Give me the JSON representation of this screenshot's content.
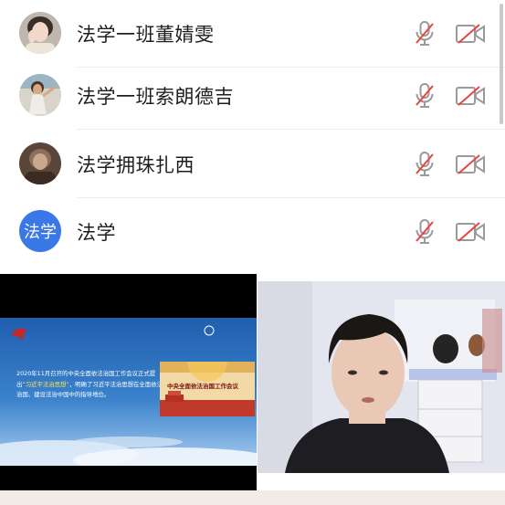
{
  "participants": [
    {
      "name": "法学一班董婧雯",
      "avatar_type": "photo",
      "mic": "muted",
      "camera": "off"
    },
    {
      "name": "法学一班索朗德吉",
      "avatar_type": "photo",
      "mic": "muted",
      "camera": "off"
    },
    {
      "name": "法学拥珠扎西",
      "avatar_type": "photo",
      "mic": "muted",
      "camera": "off"
    },
    {
      "name": "法学",
      "avatar_type": "text",
      "avatar_text": "法学",
      "mic": "muted",
      "camera": "off"
    }
  ],
  "slide": {
    "paragraph_pre": "2020年11月召开的中央全面依法治国工作会议正式提出",
    "paragraph_hl": "“习近平法治思想”",
    "paragraph_post": "，明确了习近平法治思想在全面依法治国、建设法治中国中的指导地位。",
    "poster_title": "中央全面依法治国工作会议"
  },
  "colors": {
    "accent": "#3b78e7",
    "muted_icon": "#9a9a9a",
    "muted_slash": "#e8453c"
  },
  "icons": {
    "mic": "mic-off-icon",
    "camera": "camera-off-icon"
  }
}
